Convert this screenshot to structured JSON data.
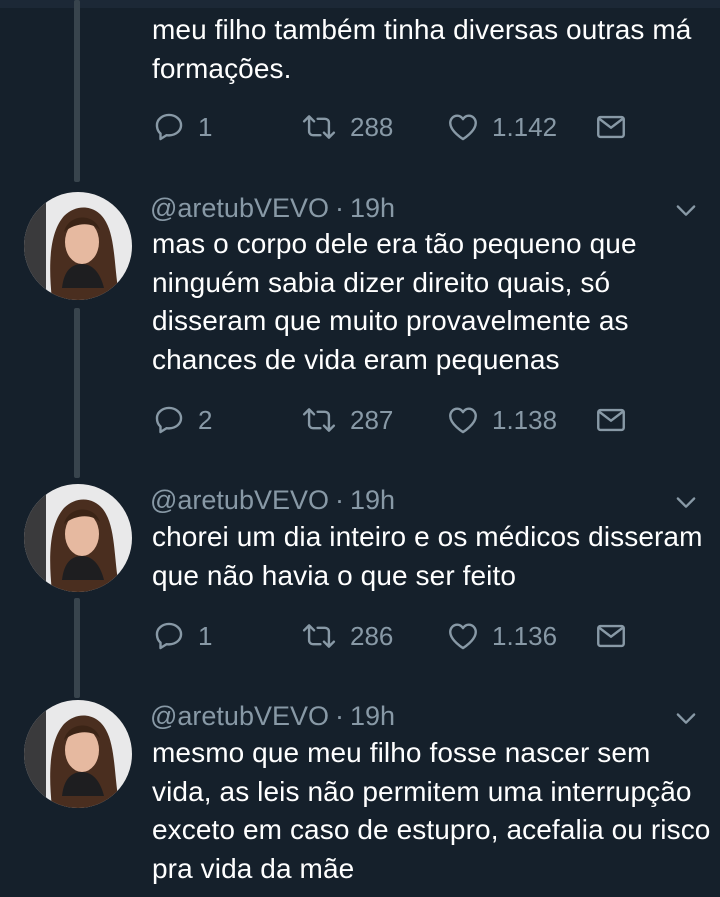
{
  "colors": {
    "background": "#15202b",
    "thread_line": "#38444d",
    "text_primary": "#ffffff",
    "text_secondary": "#8899a6"
  },
  "icons": {
    "reply": "reply-icon",
    "retweet": "retweet-icon",
    "like": "heart-icon",
    "share": "mail-icon",
    "more": "chevron-down-icon"
  },
  "tweets": [
    {
      "text": "meu filho também tinha diversas outras má formações.",
      "replies": "1",
      "retweets": "288",
      "likes": "1.142"
    },
    {
      "handle": "@aretubVEVO",
      "separator": "·",
      "time": "19h",
      "text": "mas o corpo dele era tão pequeno que ninguém sabia dizer direito quais, só disseram que muito provavelmente as chances de vida eram pequenas",
      "replies": "2",
      "retweets": "287",
      "likes": "1.138"
    },
    {
      "handle": "@aretubVEVO",
      "separator": "·",
      "time": "19h",
      "text": "chorei um dia inteiro e os médicos disseram que não havia o que ser feito",
      "replies": "1",
      "retweets": "286",
      "likes": "1.136"
    },
    {
      "handle": "@aretubVEVO",
      "separator": "·",
      "time": "19h",
      "text": "mesmo que meu filho fosse nascer sem vida, as leis não permitem uma interrupção exceto em caso de estupro, acefalia ou risco pra vida da mãe"
    }
  ]
}
